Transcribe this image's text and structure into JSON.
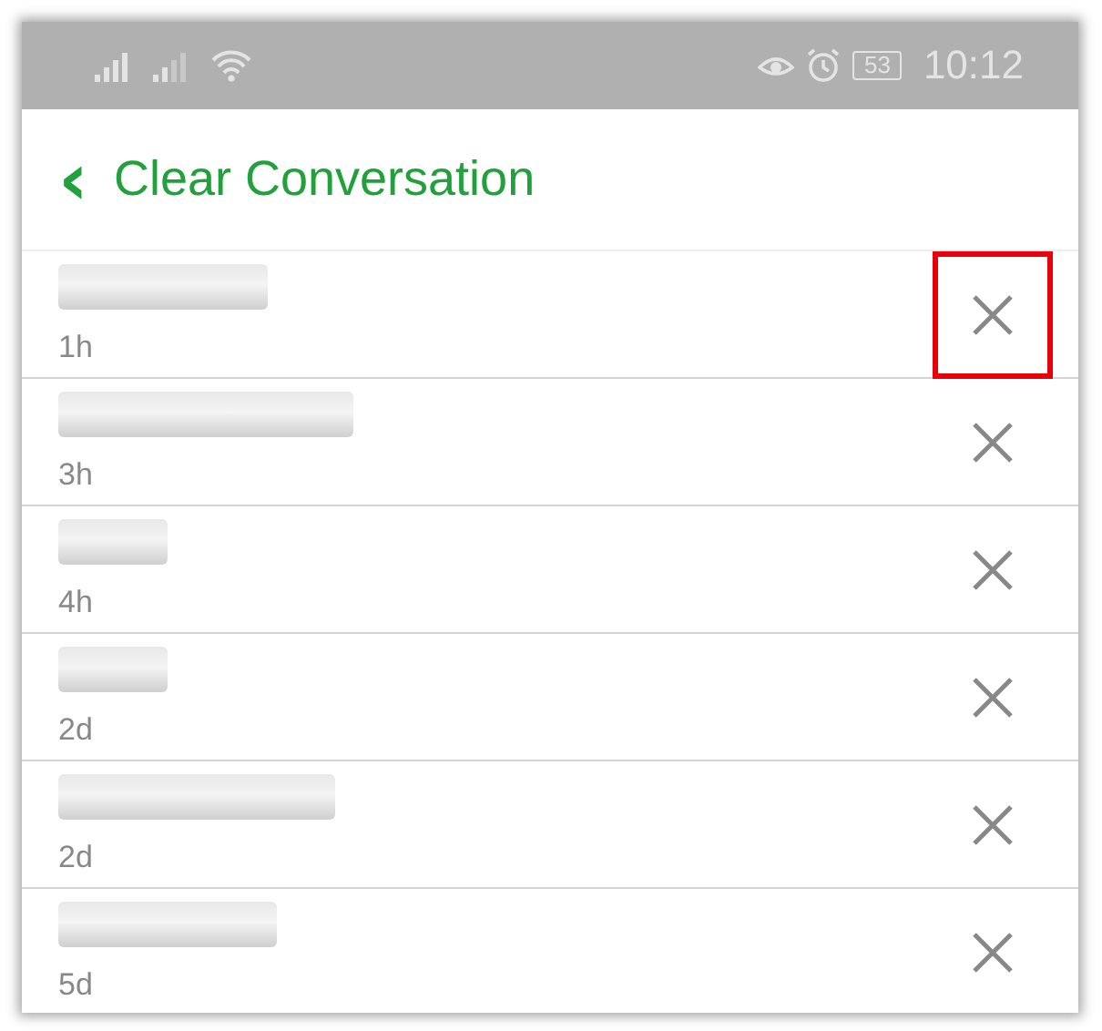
{
  "status_bar": {
    "battery": "53",
    "time": "10:12"
  },
  "header": {
    "back": "‹",
    "title": "Clear Conversation"
  },
  "conversations": [
    {
      "time": "1h",
      "highlighted": true
    },
    {
      "time": "3h",
      "highlighted": false
    },
    {
      "time": "4h",
      "highlighted": false
    },
    {
      "time": "2d",
      "highlighted": false
    },
    {
      "time": "2d",
      "highlighted": false
    },
    {
      "time": "5d",
      "highlighted": false
    }
  ]
}
